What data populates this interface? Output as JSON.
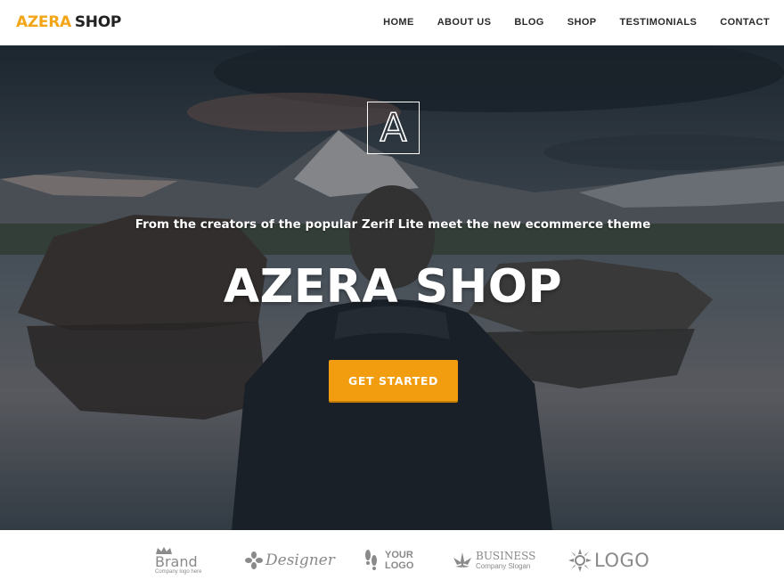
{
  "header": {
    "logo_part_a": "AZERA",
    "logo_part_b": "SHOP",
    "nav": [
      "HOME",
      "ABOUT US",
      "BLOG",
      "SHOP",
      "TESTIMONIALS",
      "CONTACT"
    ]
  },
  "hero": {
    "badge_letter": "A",
    "subtitle": "From the creators of the popular Zerif Lite meet the new ecommerce theme",
    "title": "AZERA SHOP",
    "cta_label": "GET STARTED"
  },
  "brands": {
    "brand": {
      "name": "Brand",
      "tagline": "Company logo here"
    },
    "designer": {
      "name": "Designer"
    },
    "your_logo": {
      "line1": "YOUR",
      "line2": "LOGO"
    },
    "business": {
      "name": "BUSINESS",
      "tagline": "Company Slogan"
    },
    "logo": {
      "name": "LOGO"
    }
  },
  "colors": {
    "accent": "#f29d0f",
    "logo_accent": "#f2a516",
    "nav_text": "#2a2a2a"
  },
  "icons": [
    "crown-icon",
    "flower-icon",
    "footprints-icon",
    "leaf-icon",
    "sunburst-icon"
  ]
}
